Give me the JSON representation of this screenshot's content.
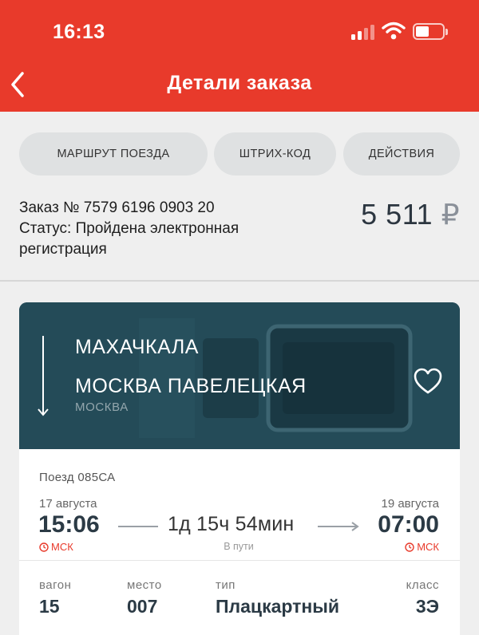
{
  "status_bar": {
    "time": "16:13"
  },
  "nav": {
    "title": "Детали заказа"
  },
  "tabs": [
    {
      "label": "МАРШРУТ ПОЕЗДА"
    },
    {
      "label": "ШТРИХ-КОД"
    },
    {
      "label": "ДЕЙСТВИЯ"
    }
  ],
  "order": {
    "number_line": "Заказ № 7579 6196 0903 20",
    "status_line1": "Статус: Пройдена электронная",
    "status_line2": "регистрация",
    "price_amount": "5 511",
    "price_currency": "₽"
  },
  "route": {
    "from": "МАХАЧКАЛА",
    "to": "МОСКВА ПАВЕЛЕЦКАЯ",
    "to_city": "МОСКВА"
  },
  "trip": {
    "train": "Поезд 085СА",
    "departure_date": "17 августа",
    "departure_time": "15:06",
    "departure_tz": "МСК",
    "duration": "1д 15ч 54мин",
    "duration_caption": "В пути",
    "arrival_date": "19 августа",
    "arrival_time": "07:00",
    "arrival_tz": "МСК"
  },
  "seat": {
    "car_label": "вагон",
    "car_value": "15",
    "seat_label": "место",
    "seat_value": "007",
    "type_label": "тип",
    "type_value": "Плацкартный",
    "class_label": "класс",
    "class_value": "3Э"
  },
  "colors": {
    "accent": "#e83a2b",
    "banner": "#244b58",
    "tab_bg": "#dfe1e2",
    "time_text": "#2b3a45"
  },
  "icons": [
    "back-chevron-icon",
    "signal-icon",
    "wifi-icon",
    "battery-icon",
    "route-arrow-icon",
    "heart-icon",
    "clock-icon",
    "arrow-right-icon"
  ]
}
